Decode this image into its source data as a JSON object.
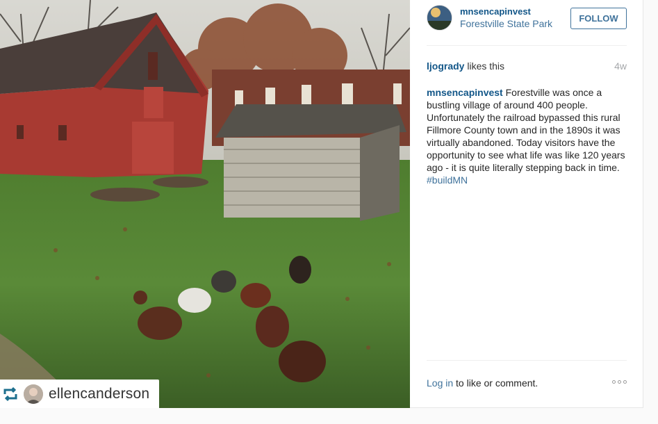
{
  "post": {
    "username": "mnsencapinvest",
    "location": "Forestville State Park",
    "follow_label": "FOLLOW",
    "likes_user": "ljogrady",
    "likes_suffix": " likes this",
    "age": "4w",
    "caption_user": "mnsencapinvest",
    "caption_text": " Forestville was once a bustling village of around 400 people. Unfortunately the railroad bypassed this rural Fillmore County town and in the 1890s it was virtually abandoned. Today visitors have the opportunity to see what life was like 120 years ago - it is quite literally stepping back in time. ",
    "caption_tag": "#buildMN",
    "login_link": "Log in",
    "login_suffix": " to like or comment."
  },
  "photo": {
    "repost_username": "ellencanderson",
    "icons": {
      "repost": "repost-icon",
      "more": "more-options-icon"
    }
  },
  "colors": {
    "link": "#125688",
    "accent": "#3f729b",
    "muted": "#a5a7aa"
  }
}
